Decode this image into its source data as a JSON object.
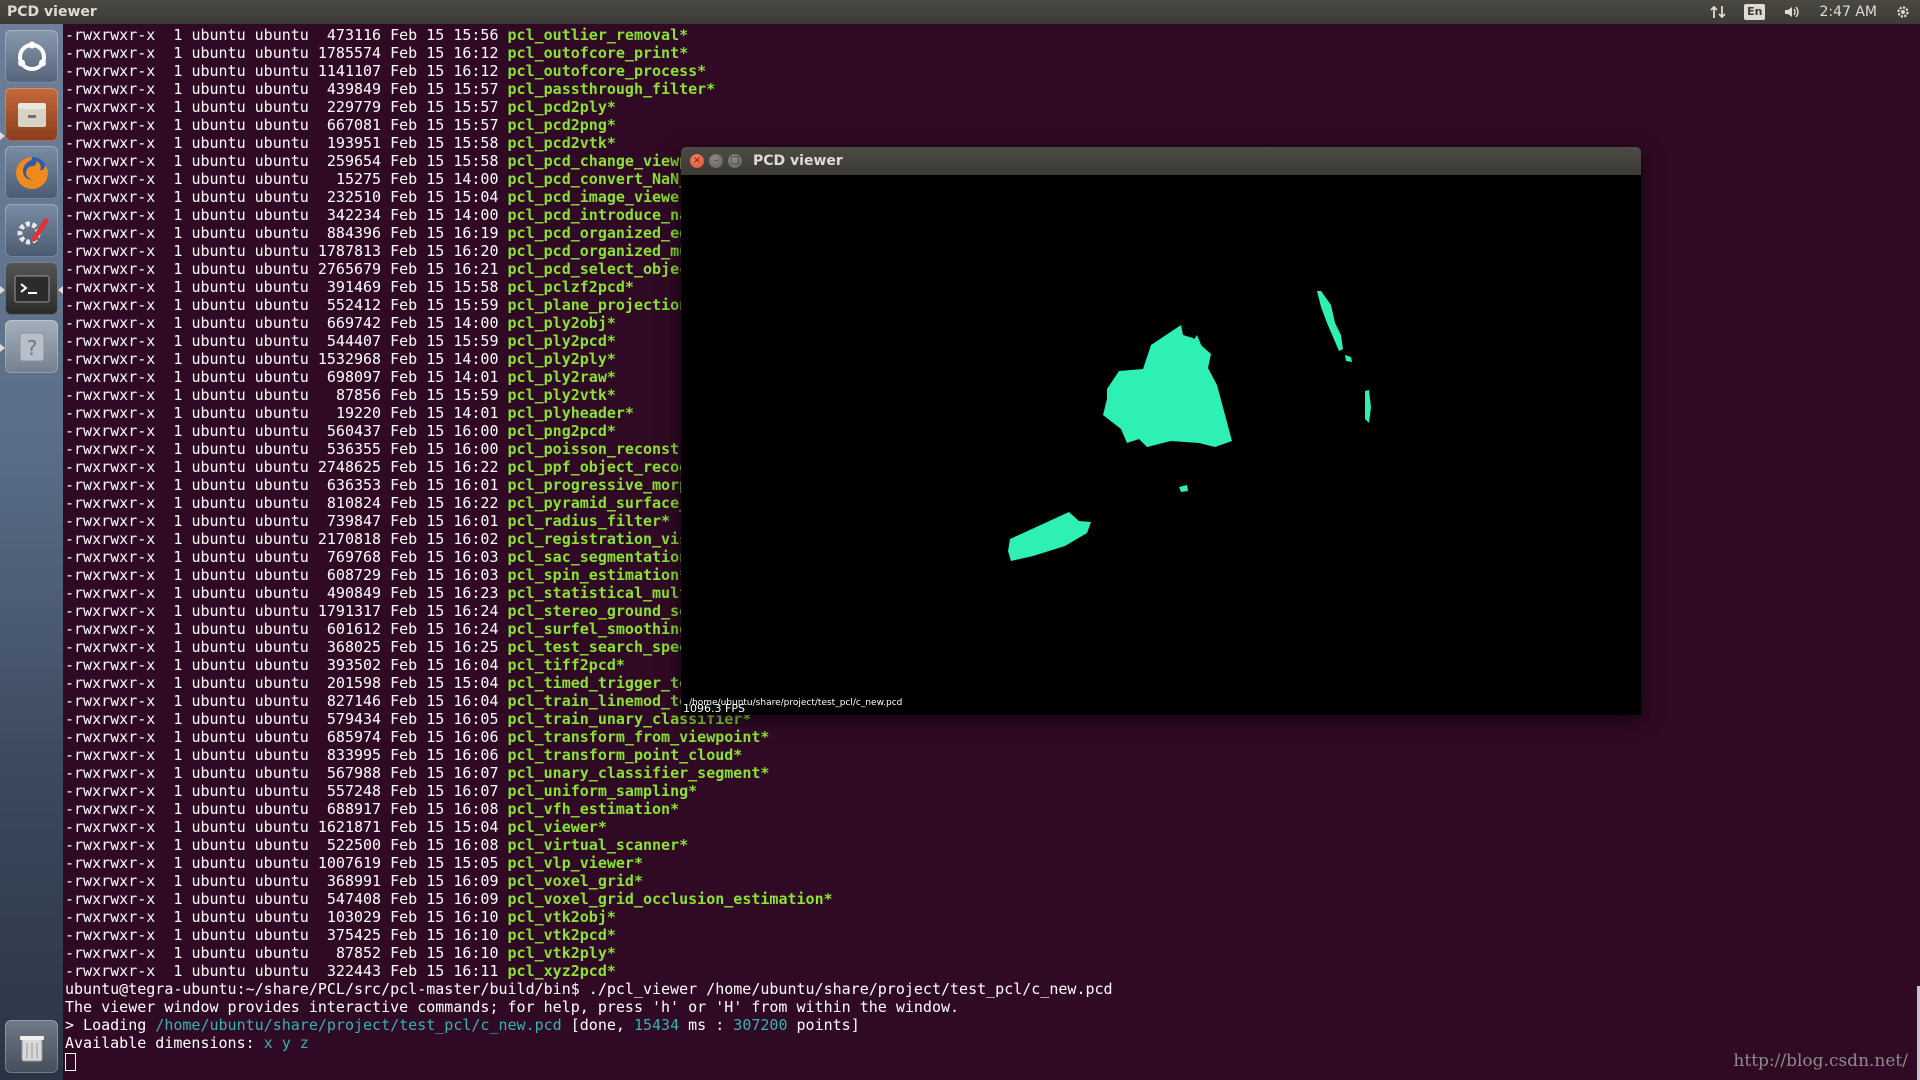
{
  "top_panel": {
    "app_title": "PCD viewer",
    "keyboard_language": "En",
    "clock": "2:47 AM"
  },
  "launcher": {
    "items": [
      {
        "name": "dash-home-icon"
      },
      {
        "name": "files-icon"
      },
      {
        "name": "firefox-icon"
      },
      {
        "name": "system-settings-icon"
      },
      {
        "name": "terminal-icon"
      },
      {
        "name": "help-icon"
      },
      {
        "name": "trash-icon"
      }
    ]
  },
  "terminal": {
    "listing": [
      {
        "perm": "-rwxrwxr-x",
        "links": "1",
        "owner": "ubuntu",
        "group": "ubuntu",
        "size": "473116",
        "date": "Feb 15 15:56",
        "file": "pcl_outlier_removal*"
      },
      {
        "perm": "-rwxrwxr-x",
        "links": "1",
        "owner": "ubuntu",
        "group": "ubuntu",
        "size": "1785574",
        "date": "Feb 15 16:12",
        "file": "pcl_outofcore_print*"
      },
      {
        "perm": "-rwxrwxr-x",
        "links": "1",
        "owner": "ubuntu",
        "group": "ubuntu",
        "size": "1141107",
        "date": "Feb 15 16:12",
        "file": "pcl_outofcore_process*"
      },
      {
        "perm": "-rwxrwxr-x",
        "links": "1",
        "owner": "ubuntu",
        "group": "ubuntu",
        "size": "439849",
        "date": "Feb 15 15:57",
        "file": "pcl_passthrough_filter*"
      },
      {
        "perm": "-rwxrwxr-x",
        "links": "1",
        "owner": "ubuntu",
        "group": "ubuntu",
        "size": "229779",
        "date": "Feb 15 15:57",
        "file": "pcl_pcd2ply*"
      },
      {
        "perm": "-rwxrwxr-x",
        "links": "1",
        "owner": "ubuntu",
        "group": "ubuntu",
        "size": "667081",
        "date": "Feb 15 15:57",
        "file": "pcl_pcd2png*"
      },
      {
        "perm": "-rwxrwxr-x",
        "links": "1",
        "owner": "ubuntu",
        "group": "ubuntu",
        "size": "193951",
        "date": "Feb 15 15:58",
        "file": "pcl_pcd2vtk*"
      },
      {
        "perm": "-rwxrwxr-x",
        "links": "1",
        "owner": "ubuntu",
        "group": "ubuntu",
        "size": "259654",
        "date": "Feb 15 15:58",
        "file": "pcl_pcd_change_viewp"
      },
      {
        "perm": "-rwxrwxr-x",
        "links": "1",
        "owner": "ubuntu",
        "group": "ubuntu",
        "size": "15275",
        "date": "Feb 15 14:00",
        "file": "pcl_pcd_convert_NaN_"
      },
      {
        "perm": "-rwxrwxr-x",
        "links": "1",
        "owner": "ubuntu",
        "group": "ubuntu",
        "size": "232510",
        "date": "Feb 15 15:04",
        "file": "pcl_pcd_image_viewer"
      },
      {
        "perm": "-rwxrwxr-x",
        "links": "1",
        "owner": "ubuntu",
        "group": "ubuntu",
        "size": "342234",
        "date": "Feb 15 14:00",
        "file": "pcl_pcd_introduce_na"
      },
      {
        "perm": "-rwxrwxr-x",
        "links": "1",
        "owner": "ubuntu",
        "group": "ubuntu",
        "size": "884396",
        "date": "Feb 15 16:19",
        "file": "pcl_pcd_organized_ed"
      },
      {
        "perm": "-rwxrwxr-x",
        "links": "1",
        "owner": "ubuntu",
        "group": "ubuntu",
        "size": "1787813",
        "date": "Feb 15 16:20",
        "file": "pcl_pcd_organized_mu"
      },
      {
        "perm": "-rwxrwxr-x",
        "links": "1",
        "owner": "ubuntu",
        "group": "ubuntu",
        "size": "2765679",
        "date": "Feb 15 16:21",
        "file": "pcl_pcd_select_objec"
      },
      {
        "perm": "-rwxrwxr-x",
        "links": "1",
        "owner": "ubuntu",
        "group": "ubuntu",
        "size": "391469",
        "date": "Feb 15 15:58",
        "file": "pcl_pclzf2pcd*"
      },
      {
        "perm": "-rwxrwxr-x",
        "links": "1",
        "owner": "ubuntu",
        "group": "ubuntu",
        "size": "552412",
        "date": "Feb 15 15:59",
        "file": "pcl_plane_projection"
      },
      {
        "perm": "-rwxrwxr-x",
        "links": "1",
        "owner": "ubuntu",
        "group": "ubuntu",
        "size": "669742",
        "date": "Feb 15 14:00",
        "file": "pcl_ply2obj*"
      },
      {
        "perm": "-rwxrwxr-x",
        "links": "1",
        "owner": "ubuntu",
        "group": "ubuntu",
        "size": "544407",
        "date": "Feb 15 15:59",
        "file": "pcl_ply2pcd*"
      },
      {
        "perm": "-rwxrwxr-x",
        "links": "1",
        "owner": "ubuntu",
        "group": "ubuntu",
        "size": "1532968",
        "date": "Feb 15 14:00",
        "file": "pcl_ply2ply*"
      },
      {
        "perm": "-rwxrwxr-x",
        "links": "1",
        "owner": "ubuntu",
        "group": "ubuntu",
        "size": "698097",
        "date": "Feb 15 14:01",
        "file": "pcl_ply2raw*"
      },
      {
        "perm": "-rwxrwxr-x",
        "links": "1",
        "owner": "ubuntu",
        "group": "ubuntu",
        "size": "87856",
        "date": "Feb 15 15:59",
        "file": "pcl_ply2vtk*"
      },
      {
        "perm": "-rwxrwxr-x",
        "links": "1",
        "owner": "ubuntu",
        "group": "ubuntu",
        "size": "19220",
        "date": "Feb 15 14:01",
        "file": "pcl_plyheader*"
      },
      {
        "perm": "-rwxrwxr-x",
        "links": "1",
        "owner": "ubuntu",
        "group": "ubuntu",
        "size": "560437",
        "date": "Feb 15 16:00",
        "file": "pcl_png2pcd*"
      },
      {
        "perm": "-rwxrwxr-x",
        "links": "1",
        "owner": "ubuntu",
        "group": "ubuntu",
        "size": "536355",
        "date": "Feb 15 16:00",
        "file": "pcl_poisson_reconstr"
      },
      {
        "perm": "-rwxrwxr-x",
        "links": "1",
        "owner": "ubuntu",
        "group": "ubuntu",
        "size": "2748625",
        "date": "Feb 15 16:22",
        "file": "pcl_ppf_object_recog"
      },
      {
        "perm": "-rwxrwxr-x",
        "links": "1",
        "owner": "ubuntu",
        "group": "ubuntu",
        "size": "636353",
        "date": "Feb 15 16:01",
        "file": "pcl_progressive_morp"
      },
      {
        "perm": "-rwxrwxr-x",
        "links": "1",
        "owner": "ubuntu",
        "group": "ubuntu",
        "size": "810824",
        "date": "Feb 15 16:22",
        "file": "pcl_pyramid_surface_"
      },
      {
        "perm": "-rwxrwxr-x",
        "links": "1",
        "owner": "ubuntu",
        "group": "ubuntu",
        "size": "739847",
        "date": "Feb 15 16:01",
        "file": "pcl_radius_filter*"
      },
      {
        "perm": "-rwxrwxr-x",
        "links": "1",
        "owner": "ubuntu",
        "group": "ubuntu",
        "size": "2170818",
        "date": "Feb 15 16:02",
        "file": "pcl_registration_vis"
      },
      {
        "perm": "-rwxrwxr-x",
        "links": "1",
        "owner": "ubuntu",
        "group": "ubuntu",
        "size": "769768",
        "date": "Feb 15 16:03",
        "file": "pcl_sac_segmentation"
      },
      {
        "perm": "-rwxrwxr-x",
        "links": "1",
        "owner": "ubuntu",
        "group": "ubuntu",
        "size": "608729",
        "date": "Feb 15 16:03",
        "file": "pcl_spin_estimation*"
      },
      {
        "perm": "-rwxrwxr-x",
        "links": "1",
        "owner": "ubuntu",
        "group": "ubuntu",
        "size": "490849",
        "date": "Feb 15 16:23",
        "file": "pcl_statistical_mult"
      },
      {
        "perm": "-rwxrwxr-x",
        "links": "1",
        "owner": "ubuntu",
        "group": "ubuntu",
        "size": "1791317",
        "date": "Feb 15 16:24",
        "file": "pcl_stereo_ground_se"
      },
      {
        "perm": "-rwxrwxr-x",
        "links": "1",
        "owner": "ubuntu",
        "group": "ubuntu",
        "size": "601612",
        "date": "Feb 15 16:24",
        "file": "pcl_surfel_smoothing"
      },
      {
        "perm": "-rwxrwxr-x",
        "links": "1",
        "owner": "ubuntu",
        "group": "ubuntu",
        "size": "368025",
        "date": "Feb 15 16:25",
        "file": "pcl_test_search_spee"
      },
      {
        "perm": "-rwxrwxr-x",
        "links": "1",
        "owner": "ubuntu",
        "group": "ubuntu",
        "size": "393502",
        "date": "Feb 15 16:04",
        "file": "pcl_tiff2pcd*"
      },
      {
        "perm": "-rwxrwxr-x",
        "links": "1",
        "owner": "ubuntu",
        "group": "ubuntu",
        "size": "201598",
        "date": "Feb 15 15:04",
        "file": "pcl_timed_trigger_te"
      },
      {
        "perm": "-rwxrwxr-x",
        "links": "1",
        "owner": "ubuntu",
        "group": "ubuntu",
        "size": "827146",
        "date": "Feb 15 16:04",
        "file": "pcl_train_linemod_te"
      },
      {
        "perm": "-rwxrwxr-x",
        "links": "1",
        "owner": "ubuntu",
        "group": "ubuntu",
        "size": "579434",
        "date": "Feb 15 16:05",
        "file": "pcl_train_unary_classifier*"
      },
      {
        "perm": "-rwxrwxr-x",
        "links": "1",
        "owner": "ubuntu",
        "group": "ubuntu",
        "size": "685974",
        "date": "Feb 15 16:06",
        "file": "pcl_transform_from_viewpoint*"
      },
      {
        "perm": "-rwxrwxr-x",
        "links": "1",
        "owner": "ubuntu",
        "group": "ubuntu",
        "size": "833995",
        "date": "Feb 15 16:06",
        "file": "pcl_transform_point_cloud*"
      },
      {
        "perm": "-rwxrwxr-x",
        "links": "1",
        "owner": "ubuntu",
        "group": "ubuntu",
        "size": "567988",
        "date": "Feb 15 16:07",
        "file": "pcl_unary_classifier_segment*"
      },
      {
        "perm": "-rwxrwxr-x",
        "links": "1",
        "owner": "ubuntu",
        "group": "ubuntu",
        "size": "557248",
        "date": "Feb 15 16:07",
        "file": "pcl_uniform_sampling*"
      },
      {
        "perm": "-rwxrwxr-x",
        "links": "1",
        "owner": "ubuntu",
        "group": "ubuntu",
        "size": "688917",
        "date": "Feb 15 16:08",
        "file": "pcl_vfh_estimation*"
      },
      {
        "perm": "-rwxrwxr-x",
        "links": "1",
        "owner": "ubuntu",
        "group": "ubuntu",
        "size": "1621871",
        "date": "Feb 15 15:04",
        "file": "pcl_viewer*"
      },
      {
        "perm": "-rwxrwxr-x",
        "links": "1",
        "owner": "ubuntu",
        "group": "ubuntu",
        "size": "522500",
        "date": "Feb 15 16:08",
        "file": "pcl_virtual_scanner*"
      },
      {
        "perm": "-rwxrwxr-x",
        "links": "1",
        "owner": "ubuntu",
        "group": "ubuntu",
        "size": "1007619",
        "date": "Feb 15 15:05",
        "file": "pcl_vlp_viewer*"
      },
      {
        "perm": "-rwxrwxr-x",
        "links": "1",
        "owner": "ubuntu",
        "group": "ubuntu",
        "size": "368991",
        "date": "Feb 15 16:09",
        "file": "pcl_voxel_grid*"
      },
      {
        "perm": "-rwxrwxr-x",
        "links": "1",
        "owner": "ubuntu",
        "group": "ubuntu",
        "size": "547408",
        "date": "Feb 15 16:09",
        "file": "pcl_voxel_grid_occlusion_estimation*"
      },
      {
        "perm": "-rwxrwxr-x",
        "links": "1",
        "owner": "ubuntu",
        "group": "ubuntu",
        "size": "103029",
        "date": "Feb 15 16:10",
        "file": "pcl_vtk2obj*"
      },
      {
        "perm": "-rwxrwxr-x",
        "links": "1",
        "owner": "ubuntu",
        "group": "ubuntu",
        "size": "375425",
        "date": "Feb 15 16:10",
        "file": "pcl_vtk2pcd*"
      },
      {
        "perm": "-rwxrwxr-x",
        "links": "1",
        "owner": "ubuntu",
        "group": "ubuntu",
        "size": "87852",
        "date": "Feb 15 16:10",
        "file": "pcl_vtk2ply*"
      },
      {
        "perm": "-rwxrwxr-x",
        "links": "1",
        "owner": "ubuntu",
        "group": "ubuntu",
        "size": "322443",
        "date": "Feb 15 16:11",
        "file": "pcl_xyz2pcd*"
      }
    ],
    "command_line": "ubuntu@tegra-ubuntu:~/share/PCL/src/pcl-master/build/bin$ ./pcl_viewer /home/ubuntu/share/project/test_pcl/c_new.pcd",
    "help_line": "The viewer window provides interactive commands; for help, press 'h' or 'H' from within the window.",
    "loading": {
      "prefix": "> Loading ",
      "path": "/home/ubuntu/share/project/test_pcl/c_new.pcd",
      "done_open": " [done, ",
      "ms_value": "15434",
      "ms_unit": " ms : ",
      "points_value": "307200",
      "points_unit": " points]"
    },
    "dimensions": {
      "label": "Available dimensions: ",
      "value": "x y z"
    },
    "watermark": "http://blog.csdn.net/"
  },
  "pcd_window": {
    "title": "PCD viewer",
    "close_glyph": "×",
    "min_glyph": "–",
    "max_glyph": "□",
    "fps": "1096.3 FPS",
    "file_label": "/home/ubuntu/share/project/test_pcl/c_new.pcd",
    "point_color": "#2ef0b4",
    "background": "#000000"
  },
  "colors": {
    "terminal_bg": "#300a24",
    "filename": "#8ae234",
    "path": "#34b3b3"
  }
}
